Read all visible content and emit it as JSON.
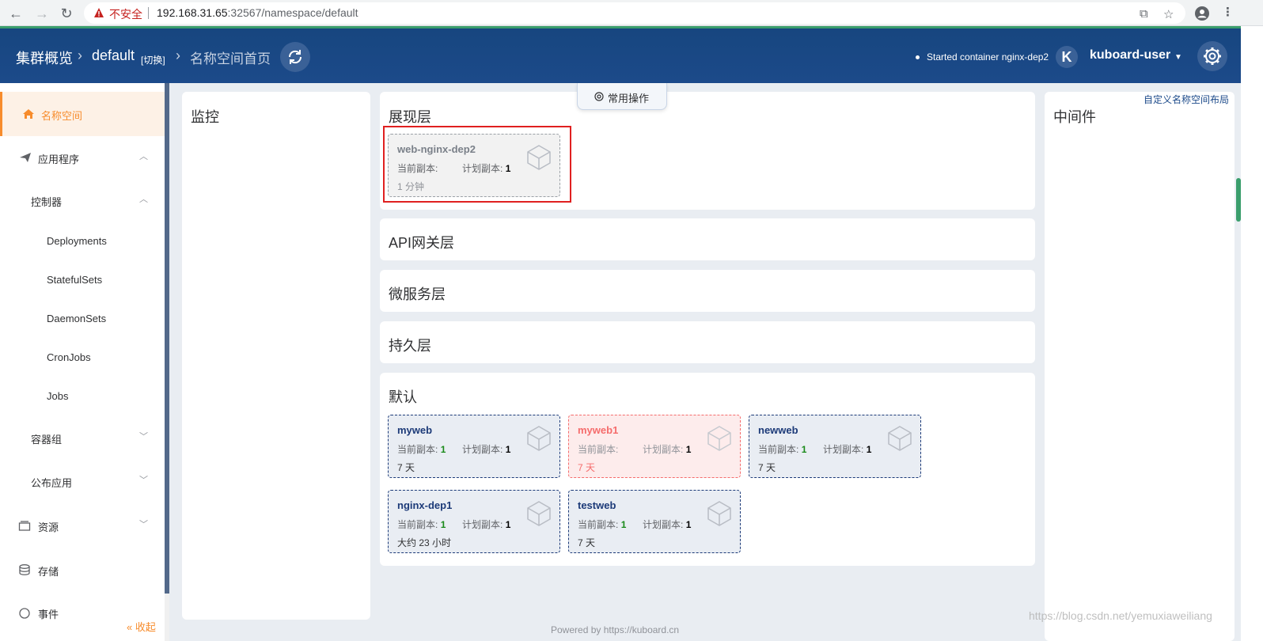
{
  "browser": {
    "insecure_label": "不安全",
    "url_host": "192.168.31.65",
    "url_rest": ":32567/namespace/default"
  },
  "header": {
    "cluster_overview": "集群概览",
    "namespace": "default",
    "switch_label": "[切换]",
    "page_title": "名称空间首页",
    "status_message": "Started container nginx-dep2",
    "user_initial": "K",
    "username": "kuboard-user"
  },
  "sidebar": {
    "items": [
      {
        "label": "名称空间"
      },
      {
        "label": "应用程序"
      },
      {
        "label": "控制器"
      },
      {
        "label": "Deployments"
      },
      {
        "label": "StatefulSets"
      },
      {
        "label": "DaemonSets"
      },
      {
        "label": "CronJobs"
      },
      {
        "label": "Jobs"
      },
      {
        "label": "容器组"
      },
      {
        "label": "公布应用"
      },
      {
        "label": "资源"
      },
      {
        "label": "存储"
      },
      {
        "label": "事件"
      }
    ],
    "collapse_label": "« 收起"
  },
  "panels": {
    "monitor_title": "监控",
    "middleware_title": "中间件",
    "common_ops_label": "常用操作",
    "custom_layout_link": "自定义名称空间布局",
    "layers": {
      "presentation": "展现层",
      "api_gateway": "API网关层",
      "microservice": "微服务层",
      "persistence": "持久层",
      "default": "默认"
    }
  },
  "cards": {
    "current_label": "当前副本:",
    "planned_label": "计划副本:",
    "presentation": [
      {
        "name": "web-nginx-dep2",
        "current": "",
        "planned": "1",
        "age": "1 分钟"
      }
    ],
    "default": [
      {
        "name": "myweb",
        "current": "1",
        "planned": "1",
        "age": "7 天"
      },
      {
        "name": "myweb1",
        "current": "",
        "planned": "1",
        "age": "7 天"
      },
      {
        "name": "newweb",
        "current": "1",
        "planned": "1",
        "age": "7 天"
      },
      {
        "name": "nginx-dep1",
        "current": "1",
        "planned": "1",
        "age": "大约 23 小时"
      },
      {
        "name": "testweb",
        "current": "1",
        "planned": "1",
        "age": "7 天"
      }
    ]
  },
  "footer": {
    "powered_by": "Powered by https://kuboard.cn"
  },
  "watermark": "https://blog.csdn.net/yemuxiaweiliang",
  "colors": {
    "header_bg": "#1c4a8a",
    "accent_orange": "#f78c2c",
    "error_red": "#f56c6c",
    "highlight_red": "#e02020"
  }
}
